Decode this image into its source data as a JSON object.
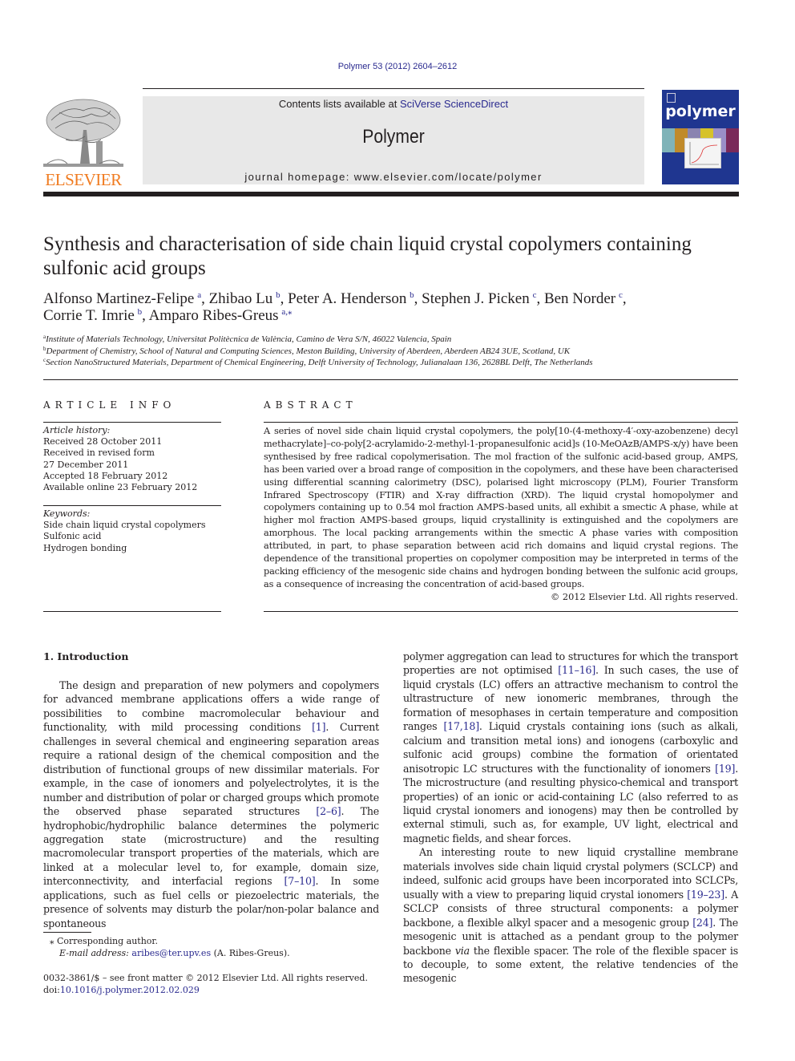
{
  "header": {
    "citation": "Polymer 53 (2012) 2604–2612",
    "contents_prefix": "Contents lists available at ",
    "contents_link": "SciVerse ScienceDirect",
    "journal_title": "Polymer",
    "homepage": "journal homepage: www.elsevier.com/locate/polymer",
    "publisher_logo": "ELSEVIER",
    "cover_title": "polymer"
  },
  "article": {
    "title_line1": "Synthesis and characterisation of side chain liquid crystal copolymers containing",
    "title_line2": "sulfonic acid groups",
    "authors": [
      {
        "name": "Alfonso Martinez-Felipe",
        "sup": "a",
        "sep": ", "
      },
      {
        "name": "Zhibao Lu",
        "sup": "b",
        "sep": ", "
      },
      {
        "name": "Peter A. Henderson",
        "sup": "b",
        "sep": ", "
      },
      {
        "name": "Stephen J. Picken",
        "sup": "c",
        "sep": ", "
      },
      {
        "name": "Ben Norder",
        "sup": "c",
        "sep": ","
      },
      {
        "name": "Corrie T. Imrie",
        "sup": "b",
        "sep": ", "
      },
      {
        "name": "Amparo Ribes-Greus",
        "sup": "a,⁎",
        "sep": ""
      }
    ],
    "affiliations": [
      {
        "key": "a",
        "text": "Institute of Materials Technology, Universitat Politècnica de València, Camino de Vera S/N, 46022 Valencia, Spain"
      },
      {
        "key": "b",
        "text": "Department of Chemistry, School of Natural and Computing Sciences, Meston Building, University of Aberdeen, Aberdeen AB24 3UE, Scotland, UK"
      },
      {
        "key": "c",
        "text": "Section NanoStructured Materials, Department of Chemical Engineering, Delft University of Technology, Julianalaan 136, 2628BL Delft, The Netherlands"
      }
    ]
  },
  "article_info": {
    "heading": "ARTICLE INFO",
    "history_label": "Article history:",
    "history": [
      "Received 28 October 2011",
      "Received in revised form",
      "27 December 2011",
      "Accepted 18 February 2012",
      "Available online 23 February 2012"
    ],
    "keywords_label": "Keywords:",
    "keywords": [
      "Side chain liquid crystal copolymers",
      "Sulfonic acid",
      "Hydrogen bonding"
    ]
  },
  "abstract": {
    "heading": "ABSTRACT",
    "text": "A series of novel side chain liquid crystal copolymers, the poly[10-(4-methoxy-4′-oxy-azobenzene) decyl methacrylate]–co-poly[2-acrylamido-2-methyl-1-propanesulfonic acid]s (10-MeOAzB/AMPS-x/y) have been synthesised by free radical copolymerisation. The mol fraction of the sulfonic acid-based group, AMPS, has been varied over a broad range of composition in the copolymers, and these have been characterised using differential scanning calorimetry (DSC), polarised light microscopy (PLM), Fourier Transform Infrared Spectroscopy (FTIR) and X-ray diffraction (XRD). The liquid crystal homopolymer and copolymers containing up to 0.54 mol fraction AMPS-based units, all exhibit a smectic A phase, while at higher mol fraction AMPS-based groups, liquid crystallinity is extinguished and the copolymers are amorphous. The local packing arrangements within the smectic A phase varies with composition attributed, in part, to phase separation between acid rich domains and liquid crystal regions. The dependence of the transitional properties on copolymer composition may be interpreted in terms of the packing efficiency of the mesogenic side chains and hydrogen bonding between the sulfonic acid groups, as a consequence of increasing the concentration of acid-based groups.",
    "copyright": "© 2012 Elsevier Ltd. All rights reserved."
  },
  "body": {
    "section_title": "1.  Introduction",
    "left_col": [
      {
        "t": "The design and preparation of new polymers and copolymers for advanced membrane applications offers a wide range of possibilities to combine macromolecular behaviour and functionality, with mild processing conditions "
      },
      {
        "ref": "[1]"
      },
      {
        "t": ". Current challenges in several chemical and engineering separation areas require a rational design of the chemical composition and the distribution of functional groups of new dissimilar materials. For example, in the case of ionomers and polyelectrolytes, it is the number and distribution of polar or charged groups which promote the observed phase separated structures "
      },
      {
        "ref": "[2–6]"
      },
      {
        "t": ". The hydrophobic/hydrophilic balance determines the polymeric aggregation state (microstructure) and the resulting macromolecular transport properties of the materials, which are linked at a molecular level to, for example, domain size, interconnectivity, and interfacial regions "
      },
      {
        "ref": "[7–10]"
      },
      {
        "t": ". In some applications, such as fuel cells or piezoelectric materials, the presence of solvents may disturb the polar/non-polar balance and spontaneous"
      }
    ],
    "right_col_p1": [
      {
        "t": "polymer aggregation can lead to structures for which the transport properties are not optimised "
      },
      {
        "ref": "[11–16]"
      },
      {
        "t": ". In such cases, the use of liquid crystals (LC) offers an attractive mechanism to control the ultrastructure of new ionomeric membranes, through the formation of mesophases in certain temperature and composition ranges "
      },
      {
        "ref": "[17,18]"
      },
      {
        "t": ". Liquid crystals containing ions (such as alkali, calcium and transition metal ions) and ionogens (carboxylic and sulfonic acid groups) combine the formation of orientated anisotropic LC structures with the functionality of ionomers "
      },
      {
        "ref": "[19]"
      },
      {
        "t": ". The microstructure (and resulting physico-chemical and transport properties) of an ionic or acid-containing LC (also referred to as liquid crystal ionomers and ionogens) may then be controlled by external stimuli, such as, for example, UV light, electrical and magnetic fields, and shear forces."
      }
    ],
    "right_col_p2": [
      {
        "t": "An interesting route to new liquid crystalline membrane materials involves side chain liquid crystal polymers (SCLCP) and indeed, sulfonic acid groups have been incorporated into SCLCPs, usually with a view to preparing liquid crystal ionomers "
      },
      {
        "ref": "[19–23]"
      },
      {
        "t": ". A SCLCP consists of three structural components: a polymer backbone, a flexible alkyl spacer and a mesogenic group "
      },
      {
        "ref": "[24]"
      },
      {
        "t": ". The mesogenic unit is attached as a pendant group to the polymer backbone "
      },
      {
        "i": "via"
      },
      {
        "t": " the flexible spacer. The role of the flexible spacer is to decouple, to some extent, the relative tendencies of the mesogenic"
      }
    ]
  },
  "footnotes": {
    "corresponding": "⁎  Corresponding author.",
    "email_label": "E-mail address:",
    "email": "aribes@ter.upv.es",
    "email_suffix": " (A. Ribes-Greus)."
  },
  "front_matter": {
    "issn_line": "0032-3861/$ – see front matter © 2012 Elsevier Ltd. All rights reserved.",
    "doi_prefix": "doi:",
    "doi": "10.1016/j.polymer.2012.02.029"
  },
  "colors": {
    "link": "#2a2a8f",
    "elsevier_orange": "#f07b20",
    "cover_blue": "#1f3690",
    "header_gray": "#e8e8e8"
  }
}
